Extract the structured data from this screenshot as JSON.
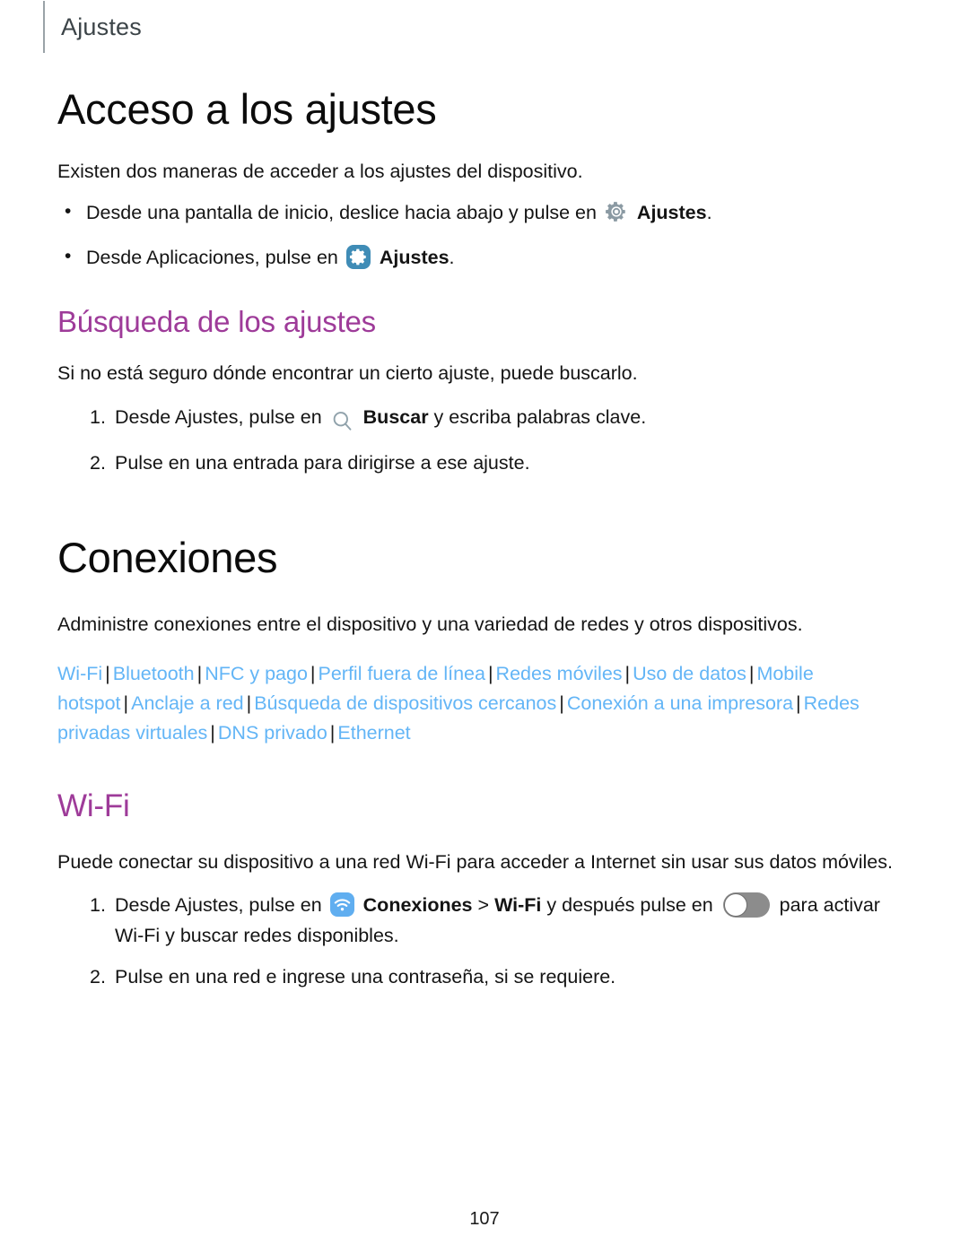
{
  "header": {
    "title": "Ajustes"
  },
  "sections": {
    "acceso": {
      "heading": "Acceso a los ajustes",
      "intro": "Existen dos maneras de acceder a los ajustes del dispositivo.",
      "bullets": [
        {
          "text_before": "Desde una pantalla de inicio, deslice hacia abajo y pulse en",
          "icon": "gear-icon",
          "bold_label": "Ajustes",
          "text_after": "."
        },
        {
          "text_before": "Desde Aplicaciones, pulse en",
          "icon": "settings-app-icon",
          "bold_label": "Ajustes",
          "text_after": "."
        }
      ]
    },
    "busqueda": {
      "heading": "Búsqueda de los ajustes",
      "intro": "Si no está seguro dónde encontrar un cierto ajuste, puede buscarlo.",
      "steps": [
        {
          "text_before": "Desde Ajustes, pulse en",
          "icon": "search-icon",
          "bold_label": "Buscar",
          "text_after": "y escriba palabras clave."
        },
        {
          "text_full": "Pulse en una entrada para dirigirse a ese ajuste."
        }
      ]
    },
    "conexiones": {
      "heading": "Conexiones",
      "intro": "Administre conexiones entre el dispositivo y una variedad de redes y otros dispositivos.",
      "separator": "|",
      "links": [
        "Wi-Fi",
        "Bluetooth",
        "NFC y pago",
        "Perfil fuera de línea",
        "Redes móviles",
        "Uso de datos",
        "Mobile hotspot",
        "Anclaje a red",
        "Búsqueda de dispositivos cercanos",
        "Conexión a una impresora",
        "Redes privadas virtuales",
        "DNS privado",
        "Ethernet"
      ]
    },
    "wifi": {
      "heading": "Wi-Fi",
      "intro": "Puede conectar su dispositivo a una red Wi-Fi para acceder a Internet sin usar sus datos móviles.",
      "steps": [
        {
          "text_before": "Desde Ajustes, pulse en",
          "icon": "wifi-app-icon",
          "bold_label": "Conexiones",
          "chevron": ">",
          "bold_label_2": "Wi-Fi",
          "text_middle": "y después pulse en",
          "toggle": "toggle-switch-off",
          "text_after": "para activar Wi-Fi y buscar redes disponibles."
        },
        {
          "text_full": "Pulse en una red e ingrese una contraseña, si se requiere."
        }
      ]
    }
  },
  "footer": {
    "page_number": "107"
  },
  "colors": {
    "heading_purple": "#9e3b99",
    "link_blue": "#63b5f6",
    "settings_badge": "#3f8cb6",
    "wifi_badge": "#60aef0",
    "gear_gray": "#8b9aa3",
    "header_gray": "#3c4448"
  }
}
